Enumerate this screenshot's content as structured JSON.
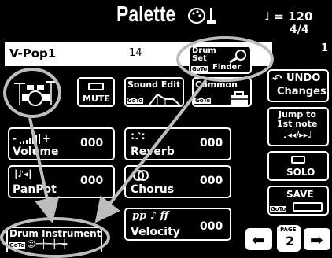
{
  "header": {
    "title": "Palette",
    "tempo": "♩ = 120",
    "time_signature": "4/4",
    "measure": "1"
  },
  "info_bar": {
    "style_name": "V-Pop1",
    "number": "14"
  },
  "toolbar": {
    "drum_set_finder": [
      "Drum",
      "Set",
      "Finder"
    ],
    "goto": "GoTo",
    "mute": "MUTE",
    "sound_edit": "Sound Edit",
    "common": "Common",
    "undo": [
      "UNDO",
      "Changes"
    ],
    "jump": [
      "Jump to",
      "1st note"
    ],
    "solo": "SOLO",
    "save": "SAVE"
  },
  "params": {
    "volume": {
      "label": "Volume",
      "value": "000"
    },
    "reverb": {
      "label": "Reverb",
      "value": "000"
    },
    "panpot": {
      "label": "PanPot",
      "value": "000"
    },
    "chorus": {
      "label": "Chorus",
      "value": "000"
    },
    "velocity": {
      "label": "Velocity",
      "value": "000"
    }
  },
  "drum_instrument": "Drum Instrument",
  "page": {
    "label": "PAGE",
    "number": "2"
  }
}
